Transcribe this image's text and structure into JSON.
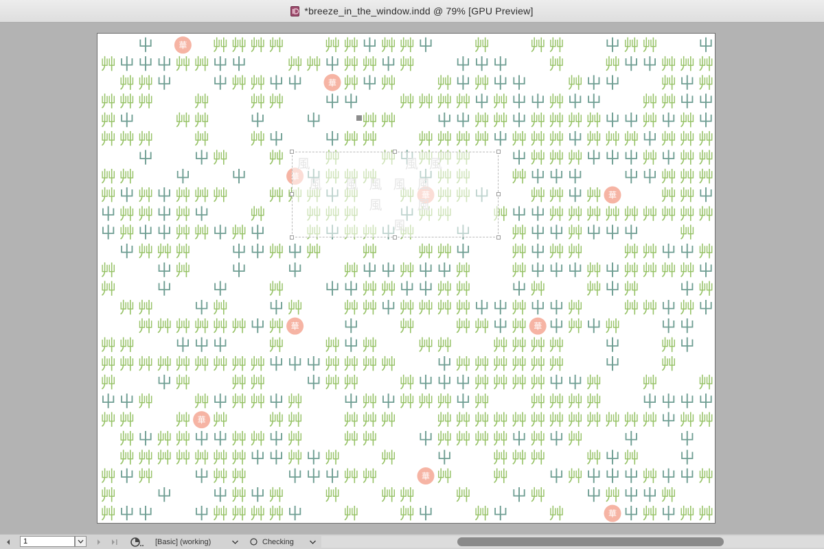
{
  "window": {
    "title": "*breeze_in_the_window.indd @ 79% [GPU Preview]",
    "doc_icon": "indesign-document-icon"
  },
  "document": {
    "glyphs": {
      "double_grass": "艸",
      "single_grass": "屮",
      "flower": "華",
      "wind": "風"
    },
    "colors": {
      "double_grass": "#96c266",
      "single_grass": "#6f9e93",
      "flower_fill": "#f6b4a4",
      "flower_text": "#ffffff",
      "wind": "#c8c8c8"
    },
    "pattern_rows": [
      "..屮.華.艸艸艸艸..艸艸屮艸艸屮..艸..艸艸..屮艸艸..屮屮..屮..華.屮..",
      "艸屮屮屮艸艸屮屮..艸艸屮艸艸屮艸..屮屮屮..艸..艸屮屮艸艸艸艸",
      ".艸艸屮..屮艸艸屮屮.華艸屮艸..艸屮艸屮屮..艸屮屮..艸屮艸",
      "艸艸艸..艸..艸艸..屮屮..艸艸艸艸屮艸屮屮艸屮屮..艸艸屮屮艸艸屮屮",
      "艸屮..艸艸..屮..屮..艸艸..屮屮艸艸屮艸艸艸艸屮屮艸屮艸屮屮屮..艸屮艸",
      "艸艸艸..艸..艸屮..屮艸艸..艸艸艸艸屮艸艸艸屮艸艸艸屮艸艸艸艸..艸屮艸",
      "..屮..屮艸..艸..艸..艸屮艸艸艸..屮艸艸艸屮屮屮艸屮艸艸..艸艸艸",
      "艸艸..屮..屮..華屮艸艸艸..屮艸艸..艸屮屮屮..屮屮艸艸艸艸..艸屮艸",
      "艸屮艸屮艸艸艸..艸艸艸屮艸..艸華艸艸屮..艸艸屮艸華..艸艸屮",
      "屮艸艸屮艸屮..艸..艸艸艸..屮艸艸..艸屮屮艸艸艸艸艸艸艸艸艸艸屮",
      "屮艸屮屮艸艸屮艸屮..艸屮艸艸屮艸..屮..艸屮屮艸屮屮屮..艸..艸屮",
      ".屮艸艸艸..屮屮艸屮艸..艸..艸艸屮..艸屮艸艸..艸艸屮屮艸艸",
      "艸..屮艸..屮..屮..艸屮屮艸屮屮艸..艸屮屮屮艸屮艸艸艸艸屮..艸",
      "艸..屮..屮..艸..屮屮艸艸屮屮艸艸..屮艸..艸屮艸..屮艸屮艸",
      ".艸艸..屮艸..屮艸..艸艸屮艸艸艸艸屮屮艸屮屮艸..艸艸屮艸屮",
      "..艸艸艸艸艸艸屮艸華..屮..艸..艸艸屮艸華屮艸屮艸..屮屮..",
      "艸艸..屮屮屮..艸..艸屮艸..艸艸..艸艸艸艸..屮..艸屮..艸艸",
      "艸艸艸艸艸艸艸艸艸屮屮屮艸艸艸艸..屮艸艸艸艸艸艸..屮..艸..華艸",
      "艸..屮艸..艸艸..屮艸艸..艸屮屮屮艸艸艸艸屮屮艸..艸..艸艸艸",
      "屮屮艸..艸屮艸艸屮艸..屮艸屮艸艸艸屮艸..艸艸艸艸..屮屮屮屮艸艸艸艸",
      "艸艸..艸華艸..艸艸..艸艸艸..艸艸艸艸艸艸艸艸艸艸艸艸屮艸艸艸",
      ".艸屮艸艸屮屮艸艸屮艸..艸艸..屮艸艸艸艸屮艸屮艸..屮..屮",
      ".艸艸艸艸艸艸艸屮屮艸屮艸..艸..屮..艸艸艸..艸屮艸..屮..屮艸",
      "艸屮艸..屮艸艸..屮屮屮艸艸..華艸..艸..屮艸屮屮屮艸屮屮艸",
      "艸..屮..屮艸屮艸..艸..艸艸..艸..屮艸..屮艸屮屮艸..屮..艸屮",
      "艸屮屮..屮艸艸艸艸屮..艸..艸屮..艸屮..艸..華屮艸屮艸艸屮艸艸"
    ],
    "wind_rows": [
      "風........風.風",
      ".風..風.風.風.風",
      "......風...風..",
      "........風...."
    ]
  },
  "statusbar": {
    "page_number": "1",
    "preflight_profile": "[Basic] (working)",
    "preflight_status": "Checking"
  },
  "scrollbar": {
    "thumb_start_fraction": 0.27,
    "thumb_size_fraction": 0.53
  }
}
